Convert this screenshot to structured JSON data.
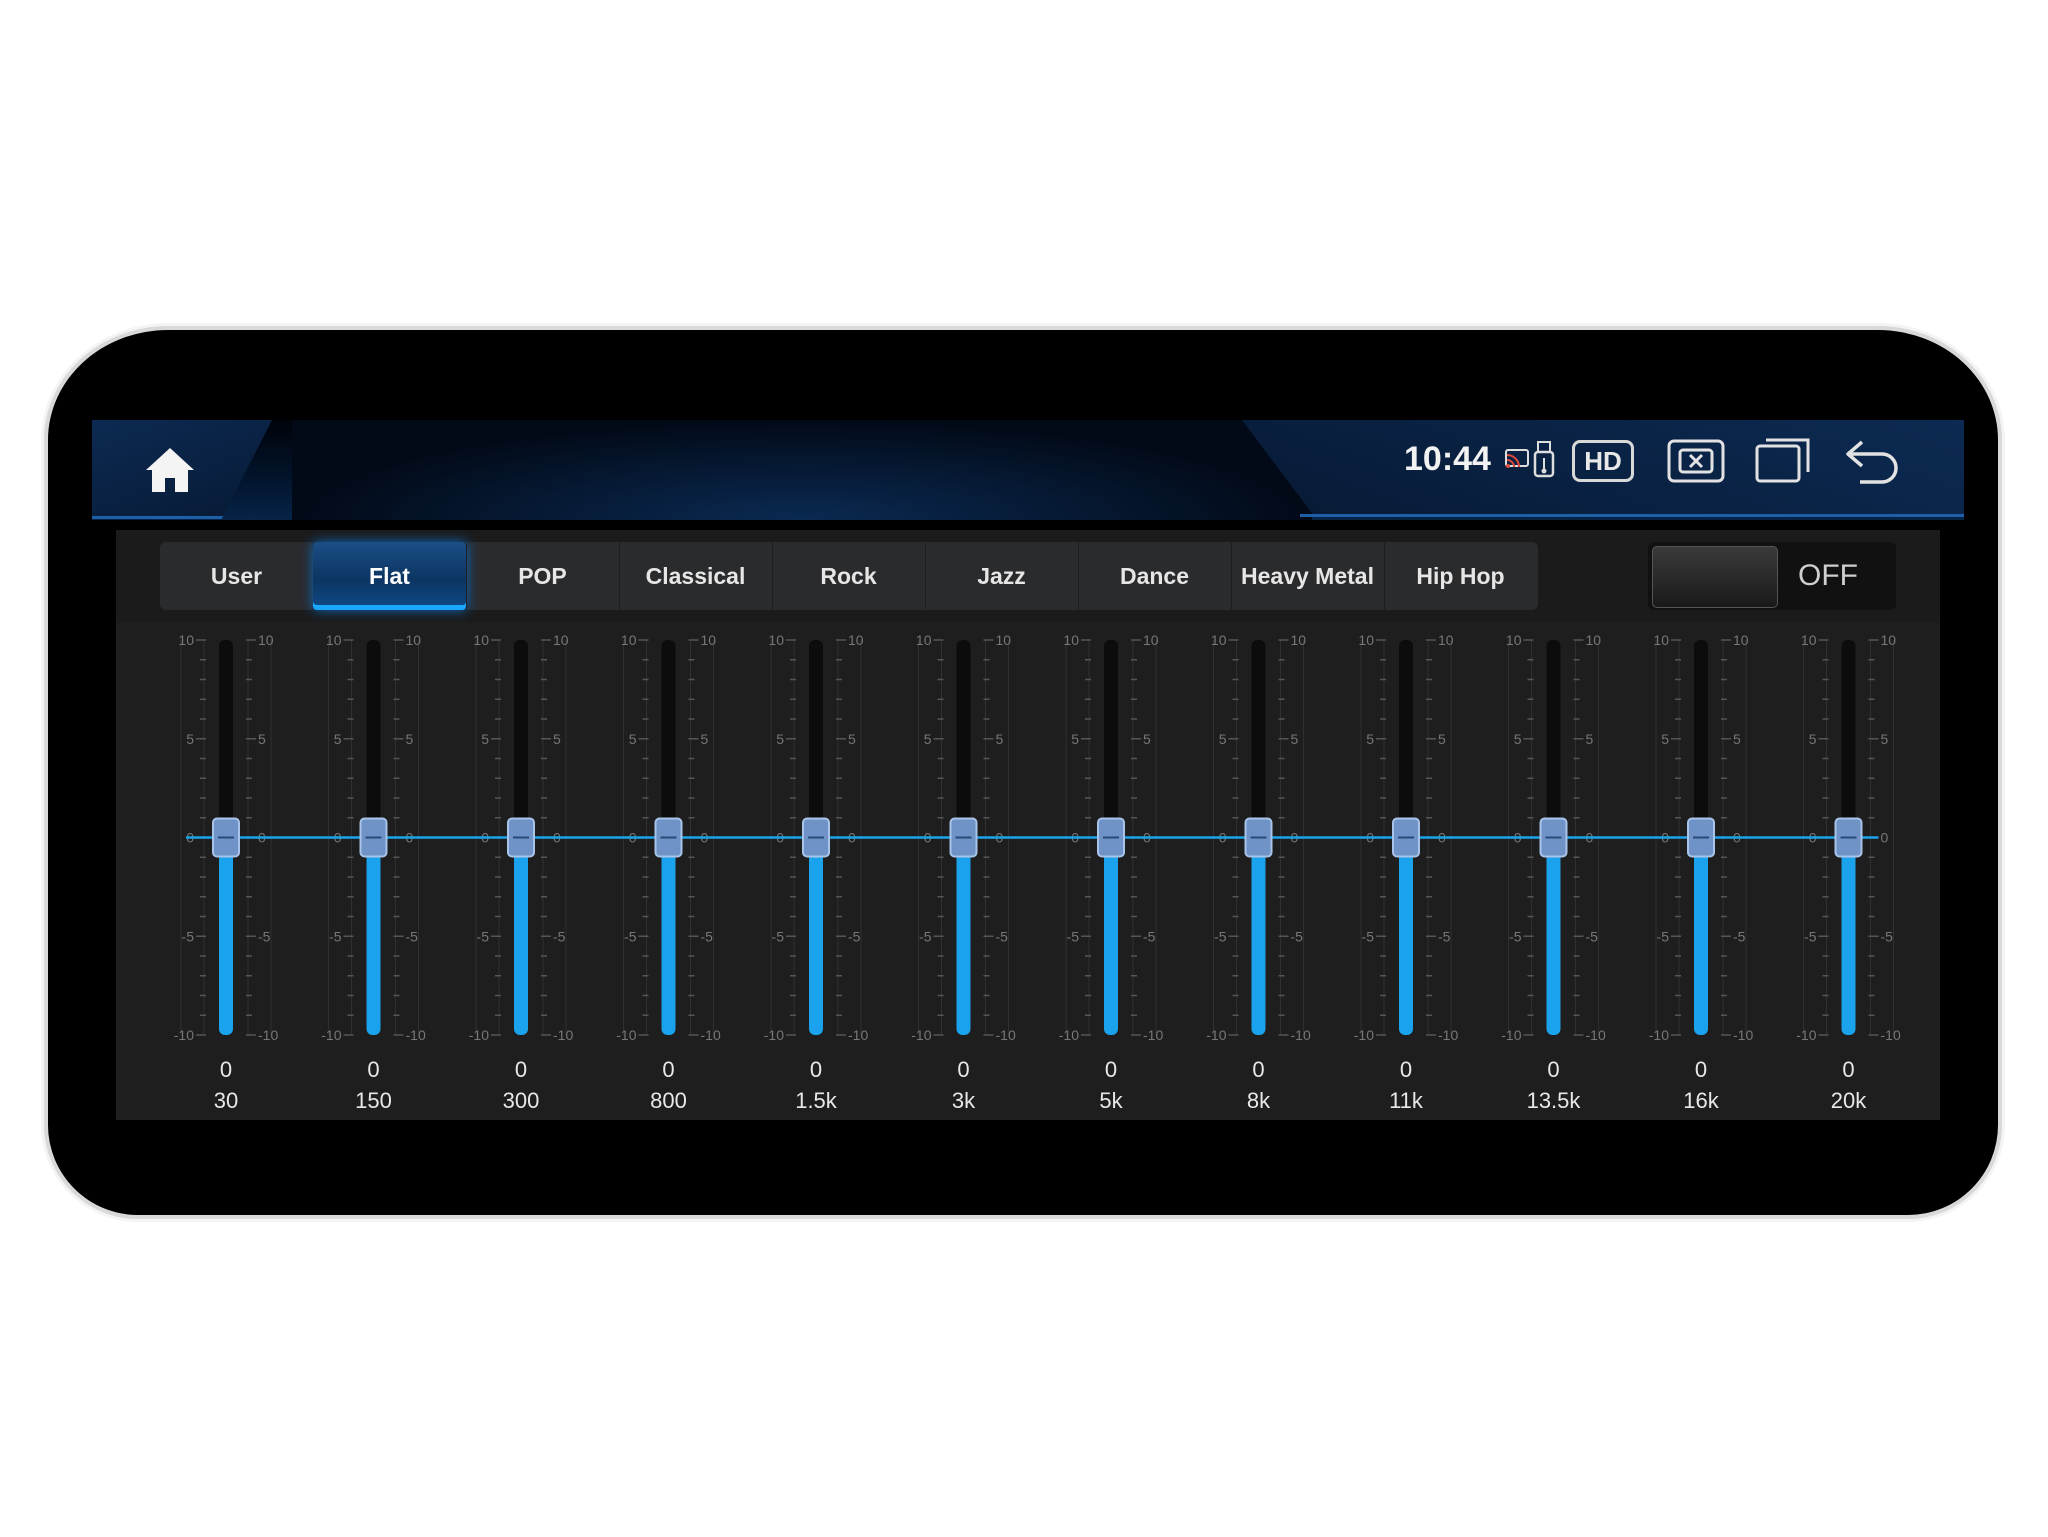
{
  "status_bar": {
    "time": "10:44",
    "hd_label": "HD",
    "icons": [
      "cast-icon",
      "usb-icon",
      "close-app-icon",
      "recent-apps-icon",
      "back-icon"
    ]
  },
  "home": {
    "icon": "home-icon"
  },
  "presets": [
    {
      "label": "User",
      "active": false
    },
    {
      "label": "Flat",
      "active": true
    },
    {
      "label": "POP",
      "active": false
    },
    {
      "label": "Classical",
      "active": false
    },
    {
      "label": "Rock",
      "active": false
    },
    {
      "label": "Jazz",
      "active": false
    },
    {
      "label": "Dance",
      "active": false
    },
    {
      "label": "Heavy Metal",
      "active": false
    },
    {
      "label": "Hip Hop",
      "active": false
    }
  ],
  "toggle": {
    "label": "OFF",
    "state": "off"
  },
  "eq": {
    "range": [
      -10,
      10
    ],
    "scale_labels": [
      "10",
      "5",
      "0",
      "-5",
      "-10"
    ],
    "bands": [
      {
        "freq": "30",
        "value": 0
      },
      {
        "freq": "150",
        "value": 0
      },
      {
        "freq": "300",
        "value": 0
      },
      {
        "freq": "800",
        "value": 0
      },
      {
        "freq": "1.5k",
        "value": 0
      },
      {
        "freq": "3k",
        "value": 0
      },
      {
        "freq": "5k",
        "value": 0
      },
      {
        "freq": "8k",
        "value": 0
      },
      {
        "freq": "11k",
        "value": 0
      },
      {
        "freq": "13.5k",
        "value": 0
      },
      {
        "freq": "16k",
        "value": 0
      },
      {
        "freq": "20k",
        "value": 0
      }
    ],
    "accent": "#1aa3ec"
  }
}
